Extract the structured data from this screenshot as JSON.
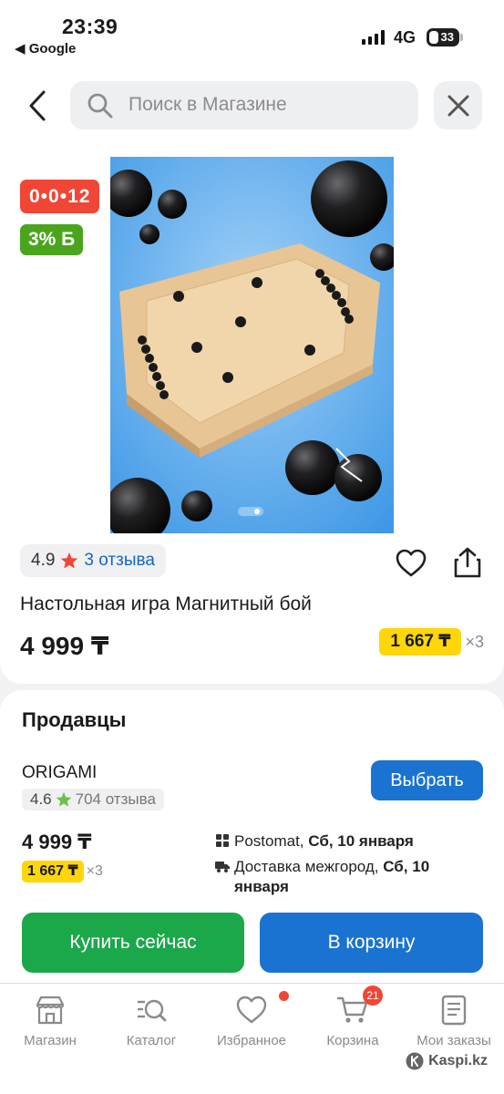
{
  "status_bar": {
    "time": "23:39",
    "back_to_app": "◀ Google",
    "network": "4G",
    "battery": "33"
  },
  "search": {
    "placeholder": "Поиск в Магазине"
  },
  "product": {
    "timer_badge": "0•0•12",
    "bonus_badge": "3% Б",
    "rating": "4.9",
    "reviews": "3 отзыва",
    "title": "Настольная игра Магнитный бой",
    "price": "4 999 ₸",
    "installment_price": "1 667 ₸",
    "installment_mult": "×3"
  },
  "sellers": {
    "heading": "Продавцы",
    "name": "ORIGAMI",
    "rating": "4.6",
    "reviews": "704 отзыва",
    "choose_label": "Выбрать",
    "price": "4 999 ₸",
    "installment_price": "1 667 ₸",
    "installment_mult": "×3",
    "delivery1_prefix": "Postomat, ",
    "delivery1_date": "Сб, 10 января",
    "delivery2_prefix": "Доставка межгород, ",
    "delivery2_date": "Сб, 10 января",
    "buy_now_label": "Купить сейчас",
    "add_to_cart_label": "В корзину"
  },
  "nav": {
    "items": [
      {
        "label": "Магазин",
        "icon": "store-icon"
      },
      {
        "label": "Каталог",
        "icon": "catalog-icon"
      },
      {
        "label": "Избранное",
        "icon": "heart-icon"
      },
      {
        "label": "Корзина",
        "icon": "cart-icon",
        "badge": "21"
      },
      {
        "label": "Мои заказы",
        "icon": "orders-icon"
      }
    ]
  },
  "watermark": "Kaspi.kz",
  "colors": {
    "red": "#f14635",
    "green_bonus": "#4aa51c",
    "blue_primary": "#1a73d0",
    "green_buy": "#1ba84a",
    "installment_yellow": "#ffd60a",
    "link_blue": "#1566c2"
  }
}
